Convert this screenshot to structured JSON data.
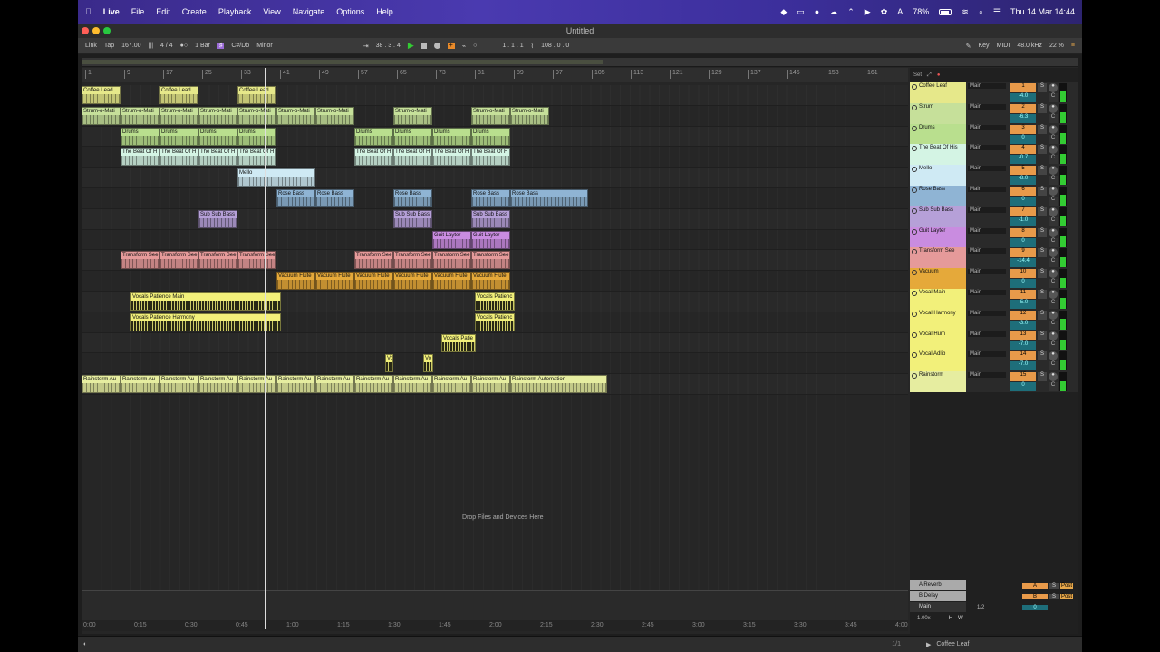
{
  "menubar": {
    "apple": "",
    "app": "Live",
    "items": [
      "File",
      "Edit",
      "Create",
      "Playback",
      "View",
      "Navigate",
      "Options",
      "Help"
    ],
    "battery": "78%",
    "clock": "Thu 14 Mar  14:44"
  },
  "window": {
    "title": "Untitled"
  },
  "control": {
    "link": "Link",
    "tap": "Tap",
    "tempo": "167.00",
    "sig": "4 / 4",
    "quant": "1 Bar",
    "key": "C#/Db",
    "scale": "Minor",
    "position": "38 .  3 .  4",
    "loop_start": "1 .  1 .  1",
    "loop_len": "108 .  0 .  0",
    "key_label": "Key",
    "midi_label": "MIDI",
    "sample_rate": "48.0 kHz",
    "cpu": "22 %"
  },
  "ruler": {
    "bars": [
      "1",
      "9",
      "17",
      "25",
      "33",
      "41",
      "49",
      "57",
      "65",
      "73",
      "81",
      "89",
      "97",
      "105",
      "113",
      "121",
      "129",
      "137",
      "145",
      "153",
      "161"
    ]
  },
  "tracks": [
    {
      "name": "Coffee Leaf",
      "color": "#e6e88a",
      "num": "1",
      "vol": "-4.0",
      "clips": [
        {
          "s": 0,
          "w": 43,
          "n": "Coffee Lead"
        },
        {
          "s": 86,
          "w": 43,
          "n": "Coffee Lead"
        },
        {
          "s": 172,
          "w": 43,
          "n": "Coffee Lead"
        }
      ]
    },
    {
      "name": "Strum",
      "color": "#c6e09a",
      "num": "2",
      "vol": "-6.3",
      "clips": [
        {
          "s": 0,
          "w": 43,
          "n": "Strum-o-Mati"
        },
        {
          "s": 43,
          "w": 43,
          "n": "Strum-o-Mati"
        },
        {
          "s": 86,
          "w": 43,
          "n": "Strum-o-Mati"
        },
        {
          "s": 129,
          "w": 43,
          "n": "Strum-o-Mati"
        },
        {
          "s": 172,
          "w": 43,
          "n": "Strum-o-Mati"
        },
        {
          "s": 215,
          "w": 43,
          "n": "Strum-o-Mati"
        },
        {
          "s": 258,
          "w": 43,
          "n": "Strum-o-Mati"
        },
        {
          "s": 344,
          "w": 43,
          "n": "Strum-o-Mati"
        },
        {
          "s": 430,
          "w": 43,
          "n": "Strum-o-Mati"
        },
        {
          "s": 473,
          "w": 43,
          "n": "Strum-o-Mati"
        }
      ]
    },
    {
      "name": "Drums",
      "color": "#b9df8e",
      "num": "3",
      "vol": "0",
      "clips": [
        {
          "s": 43,
          "w": 43,
          "n": "Drums"
        },
        {
          "s": 86,
          "w": 43,
          "n": "Drums"
        },
        {
          "s": 129,
          "w": 43,
          "n": "Drums"
        },
        {
          "s": 172,
          "w": 43,
          "n": "Drums"
        },
        {
          "s": 301,
          "w": 43,
          "n": "Drums"
        },
        {
          "s": 344,
          "w": 43,
          "n": "Drums"
        },
        {
          "s": 387,
          "w": 43,
          "n": "Drums"
        },
        {
          "s": 430,
          "w": 43,
          "n": "Drums"
        }
      ]
    },
    {
      "name": "The Beat Of His",
      "color": "#d4f4e4",
      "num": "4",
      "vol": "-0.7",
      "clips": [
        {
          "s": 43,
          "w": 43,
          "n": "The Beat Of H"
        },
        {
          "s": 86,
          "w": 43,
          "n": "The Beat Of H"
        },
        {
          "s": 129,
          "w": 43,
          "n": "The Beat Of H"
        },
        {
          "s": 172,
          "w": 43,
          "n": "The Beat Of H"
        },
        {
          "s": 301,
          "w": 43,
          "n": "The Beat Of H"
        },
        {
          "s": 344,
          "w": 43,
          "n": "The Beat Of H"
        },
        {
          "s": 387,
          "w": 43,
          "n": "The Beat Of H"
        },
        {
          "s": 430,
          "w": 43,
          "n": "The Beat Of H"
        }
      ]
    },
    {
      "name": "Mello",
      "color": "#cfeaf4",
      "num": "5",
      "vol": "-8.0",
      "clips": [
        {
          "s": 172,
          "w": 86,
          "n": "Mello"
        }
      ]
    },
    {
      "name": "Rose Bass",
      "color": "#8fb4d4",
      "num": "6",
      "vol": "0",
      "clips": [
        {
          "s": 215,
          "w": 43,
          "n": "Rose Bass"
        },
        {
          "s": 258,
          "w": 43,
          "n": "Rose Bass"
        },
        {
          "s": 344,
          "w": 43,
          "n": "Rose Bass"
        },
        {
          "s": 430,
          "w": 43,
          "n": "Rose Bass"
        },
        {
          "s": 473,
          "w": 86,
          "n": "Rose Bass"
        }
      ]
    },
    {
      "name": "Sub Sub Bass",
      "color": "#b6a0d8",
      "num": "7",
      "vol": "-1.0",
      "clips": [
        {
          "s": 129,
          "w": 43,
          "n": "Sub Sub Bass"
        },
        {
          "s": 344,
          "w": 43,
          "n": "Sub Sub Bass"
        },
        {
          "s": 430,
          "w": 43,
          "n": "Sub Sub Bass"
        }
      ]
    },
    {
      "name": "Guit Layter",
      "color": "#c98ce0",
      "num": "8",
      "vol": "0",
      "clips": [
        {
          "s": 387,
          "w": 43,
          "n": "Guit Layter"
        },
        {
          "s": 430,
          "w": 43,
          "n": "Guit Layter"
        }
      ]
    },
    {
      "name": "Transform See",
      "color": "#e59a9a",
      "num": "9",
      "vol": "-14.4",
      "clips": [
        {
          "s": 43,
          "w": 43,
          "n": "Transform See"
        },
        {
          "s": 86,
          "w": 43,
          "n": "Transform See"
        },
        {
          "s": 129,
          "w": 43,
          "n": "Transform See"
        },
        {
          "s": 172,
          "w": 43,
          "n": "Transform See"
        },
        {
          "s": 301,
          "w": 43,
          "n": "Transform See"
        },
        {
          "s": 344,
          "w": 43,
          "n": "Transform See"
        },
        {
          "s": 387,
          "w": 43,
          "n": "Transform See"
        },
        {
          "s": 430,
          "w": 43,
          "n": "Transform See"
        }
      ]
    },
    {
      "name": "Vacuum",
      "color": "#e5a93a",
      "num": "10",
      "vol": "0",
      "clips": [
        {
          "s": 215,
          "w": 43,
          "n": "Vacuum Flute"
        },
        {
          "s": 258,
          "w": 43,
          "n": "Vacuum Flute"
        },
        {
          "s": 301,
          "w": 43,
          "n": "Vacuum Flute"
        },
        {
          "s": 344,
          "w": 43,
          "n": "Vacuum Flute"
        },
        {
          "s": 387,
          "w": 43,
          "n": "Vacuum Flute"
        },
        {
          "s": 430,
          "w": 43,
          "n": "Vacuum Flute"
        }
      ]
    },
    {
      "name": "Vocal Main",
      "color": "#f2f07a",
      "num": "11",
      "vol": "-5.0",
      "clips": [
        {
          "s": 54,
          "w": 166,
          "n": "Vocals Patience Main"
        },
        {
          "s": 434,
          "w": 44,
          "n": "Vocals Patienc"
        }
      ]
    },
    {
      "name": "Vocal Harmony",
      "color": "#f2f07a",
      "num": "12",
      "vol": "-3.0",
      "clips": [
        {
          "s": 54,
          "w": 166,
          "n": "Vocals Patience Harmony"
        },
        {
          "s": 434,
          "w": 44,
          "n": "Vocals Patienc"
        }
      ]
    },
    {
      "name": "Vocal Hum",
      "color": "#f2f07a",
      "num": "13",
      "vol": "-7.0",
      "clips": [
        {
          "s": 397,
          "w": 38,
          "n": "Vocals Patie"
        }
      ]
    },
    {
      "name": "Vocal Adlib",
      "color": "#f2f07a",
      "num": "14",
      "vol": "-7.0",
      "clips": [
        {
          "s": 335,
          "w": 9,
          "n": "Vo"
        },
        {
          "s": 377,
          "w": 11,
          "n": "Vo"
        }
      ]
    },
    {
      "name": "Rainstorm",
      "color": "#e6eda0",
      "num": "15",
      "vol": "0",
      "clips": [
        {
          "s": 0,
          "w": 43,
          "n": "Rainstorm Au"
        },
        {
          "s": 43,
          "w": 43,
          "n": "Rainstorm Au"
        },
        {
          "s": 86,
          "w": 43,
          "n": "Rainstorm Au"
        },
        {
          "s": 129,
          "w": 43,
          "n": "Rainstorm Au"
        },
        {
          "s": 172,
          "w": 43,
          "n": "Rainstorm Au"
        },
        {
          "s": 215,
          "w": 43,
          "n": "Rainstorm Au"
        },
        {
          "s": 258,
          "w": 43,
          "n": "Rainstorm Au"
        },
        {
          "s": 301,
          "w": 43,
          "n": "Rainstorm Au"
        },
        {
          "s": 344,
          "w": 43,
          "n": "Rainstorm Au"
        },
        {
          "s": 387,
          "w": 43,
          "n": "Rainstorm Au"
        },
        {
          "s": 430,
          "w": 43,
          "n": "Rainstorm Au"
        },
        {
          "s": 473,
          "w": 107,
          "n": "Rainstorm Automation"
        }
      ]
    }
  ],
  "returns": [
    {
      "name": "A Reverb",
      "letter": "A",
      "post": "Post"
    },
    {
      "name": "B Delay",
      "letter": "B",
      "post": "Post"
    }
  ],
  "master": {
    "name": "Main",
    "sel": "1/2",
    "vol": "0",
    "page": "1/1",
    "zoom": "1.00x"
  },
  "drop_text": "Drop Files and Devices Here",
  "time_ruler": [
    "0:00",
    "0:15",
    "0:30",
    "0:45",
    "1:00",
    "1:15",
    "1:30",
    "1:45",
    "2:00",
    "2:15",
    "2:30",
    "2:45",
    "3:00",
    "3:15",
    "3:30",
    "3:45",
    "4:00"
  ],
  "mixer_head": {
    "set": "Set"
  },
  "io_label": "Main",
  "status": {
    "selected_track": "Coffee Leaf",
    "h": "H",
    "w": "W"
  }
}
